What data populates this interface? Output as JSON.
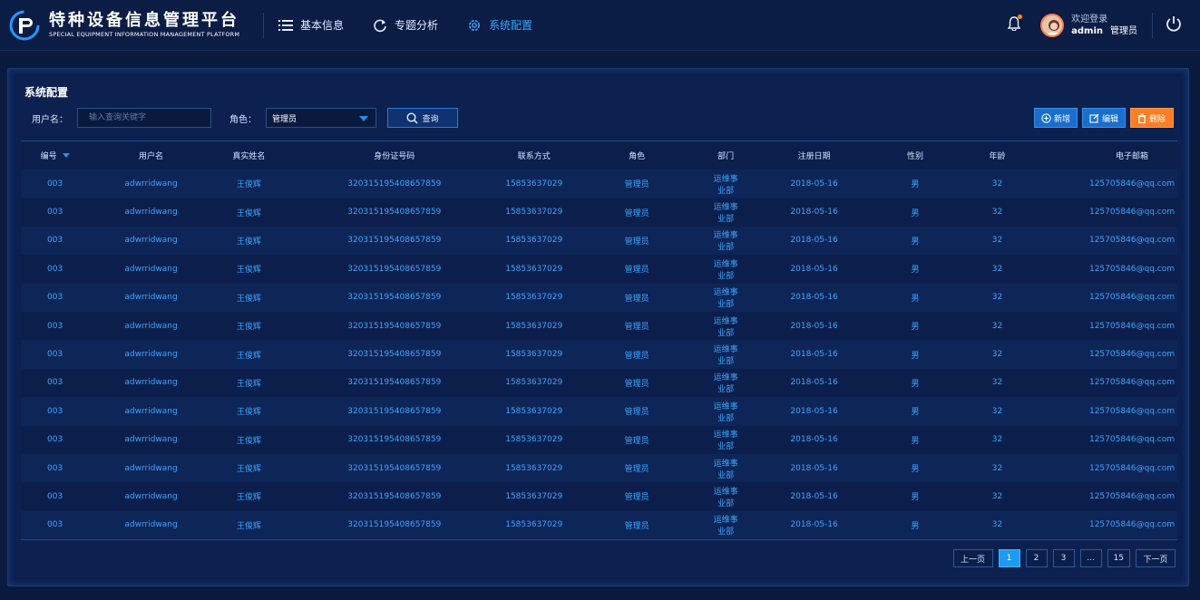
{
  "app": {
    "title": "特种设备信息管理平台",
    "subtitle": "SPECIAL EQUIPMENT INFORMATION MANAGEMENT PLATFORM"
  },
  "nav": {
    "items": [
      {
        "label": "基本信息",
        "icon": "list-icon",
        "active": false
      },
      {
        "label": "专题分析",
        "icon": "refresh-icon",
        "active": false
      },
      {
        "label": "系统配置",
        "icon": "gear-icon",
        "active": true
      }
    ]
  },
  "user": {
    "welcome": "欢迎登录",
    "name": "admin",
    "role": "管理员"
  },
  "panel": {
    "title": "系统配置"
  },
  "filters": {
    "username_label": "用户名：",
    "username_placeholder": "输入查询关键字",
    "role_label": "角色：",
    "role_value": "管理员",
    "search_label": "查询"
  },
  "actions": {
    "add_label": "新增",
    "edit_label": "编辑",
    "delete_label": "删除"
  },
  "table": {
    "columns": [
      "编号",
      "用户名",
      "真实姓名",
      "身份证号码",
      "联系方式",
      "角色",
      "部门",
      "注册日期",
      "性别",
      "年龄",
      "电子邮箱"
    ],
    "rows": [
      [
        "003",
        "adwrridwang",
        "王俊辉",
        "320315195408657859",
        "15853637029",
        "管理员",
        "运维事业部",
        "2018-05-16",
        "男",
        "32",
        "125705846@qq.com"
      ],
      [
        "003",
        "adwrridwang",
        "王俊辉",
        "320315195408657859",
        "15853637029",
        "管理员",
        "运维事业部",
        "2018-05-16",
        "男",
        "32",
        "125705846@qq.com"
      ],
      [
        "003",
        "adwrridwang",
        "王俊辉",
        "320315195408657859",
        "15853637029",
        "管理员",
        "运维事业部",
        "2018-05-16",
        "男",
        "32",
        "125705846@qq.com"
      ],
      [
        "003",
        "adwrridwang",
        "王俊辉",
        "320315195408657859",
        "15853637029",
        "管理员",
        "运维事业部",
        "2018-05-16",
        "男",
        "32",
        "125705846@qq.com"
      ],
      [
        "003",
        "adwrridwang",
        "王俊辉",
        "320315195408657859",
        "15853637029",
        "管理员",
        "运维事业部",
        "2018-05-16",
        "男",
        "32",
        "125705846@qq.com"
      ],
      [
        "003",
        "adwrridwang",
        "王俊辉",
        "320315195408657859",
        "15853637029",
        "管理员",
        "运维事业部",
        "2018-05-16",
        "男",
        "32",
        "125705846@qq.com"
      ],
      [
        "003",
        "adwrridwang",
        "王俊辉",
        "320315195408657859",
        "15853637029",
        "管理员",
        "运维事业部",
        "2018-05-16",
        "男",
        "32",
        "125705846@qq.com"
      ],
      [
        "003",
        "adwrridwang",
        "王俊辉",
        "320315195408657859",
        "15853637029",
        "管理员",
        "运维事业部",
        "2018-05-16",
        "男",
        "32",
        "125705846@qq.com"
      ],
      [
        "003",
        "adwrridwang",
        "王俊辉",
        "320315195408657859",
        "15853637029",
        "管理员",
        "运维事业部",
        "2018-05-16",
        "男",
        "32",
        "125705846@qq.com"
      ],
      [
        "003",
        "adwrridwang",
        "王俊辉",
        "320315195408657859",
        "15853637029",
        "管理员",
        "运维事业部",
        "2018-05-16",
        "男",
        "32",
        "125705846@qq.com"
      ],
      [
        "003",
        "adwrridwang",
        "王俊辉",
        "320315195408657859",
        "15853637029",
        "管理员",
        "运维事业部",
        "2018-05-16",
        "男",
        "32",
        "125705846@qq.com"
      ],
      [
        "003",
        "adwrridwang",
        "王俊辉",
        "320315195408657859",
        "15853637029",
        "管理员",
        "运维事业部",
        "2018-05-16",
        "男",
        "32",
        "125705846@qq.com"
      ],
      [
        "003",
        "adwrridwang",
        "王俊辉",
        "320315195408657859",
        "15853637029",
        "管理员",
        "运维事业部",
        "2018-05-16",
        "男",
        "32",
        "125705846@qq.com"
      ]
    ]
  },
  "pagination": {
    "prev_label": "上一页",
    "pages": [
      "1",
      "2",
      "3",
      "...",
      "15"
    ],
    "current": "1",
    "next_label": "下一页"
  },
  "colors": {
    "background": "#0a1a3f",
    "accent": "#33a8ff",
    "cell_text": "#3aa6ff",
    "delete": "#ff7e24",
    "active_page": "#1d9bf0"
  }
}
